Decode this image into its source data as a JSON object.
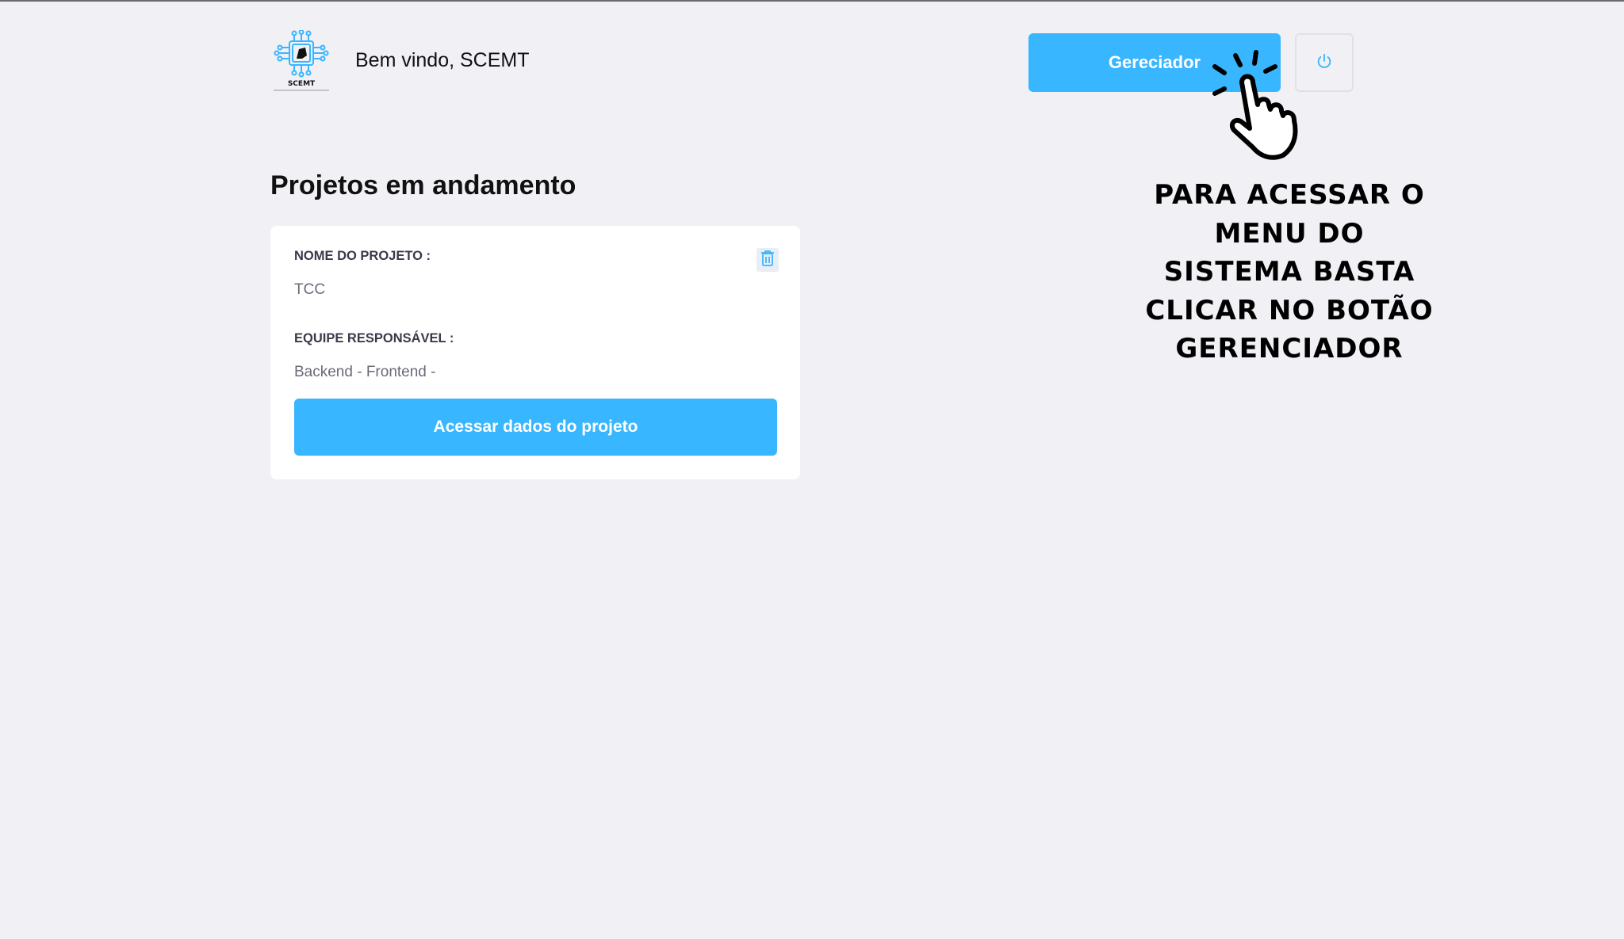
{
  "header": {
    "logo_text": "SCEMT",
    "welcome": "Bem vindo, SCEMT",
    "manager_button": "Gereciador",
    "power_icon": "power-icon"
  },
  "annotation": {
    "hand_icon": "pointing-hand-icon",
    "text": "Para acessar o menu do sistema basta clicar no botão Gerenciador"
  },
  "main": {
    "section_title": "Projetos em andamento",
    "project_card": {
      "name_label": "NOME DO PROJETO :",
      "name_value": "TCC",
      "team_label": "EQUIPE RESPONSÁVEL :",
      "team_value": "Backend - Frontend -",
      "delete_icon": "trash-icon",
      "access_button": "Acessar dados do projeto"
    }
  },
  "colors": {
    "background": "#f0f0f5",
    "accent": "#38b6ff",
    "card": "#ffffff"
  }
}
